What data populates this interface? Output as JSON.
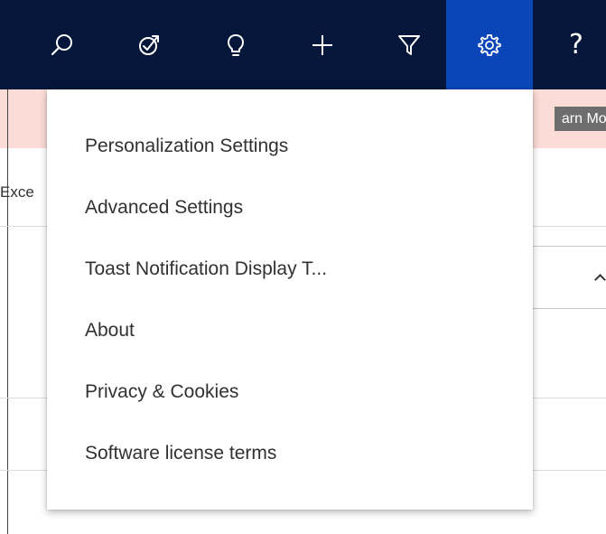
{
  "topbar": {
    "background": "#04173a",
    "active_background": "#0b46b8",
    "buttons": [
      {
        "icon": "search-icon"
      },
      {
        "icon": "task-flow-icon"
      },
      {
        "icon": "lightbulb-icon"
      },
      {
        "icon": "plus-icon"
      },
      {
        "icon": "filter-icon"
      },
      {
        "icon": "gear-icon",
        "active": true
      },
      {
        "icon": "help-icon",
        "glyph": "?"
      }
    ]
  },
  "background_page": {
    "banner_color": "#fbdcd6",
    "learn_more_label": "arn Mor",
    "excel_text": "Exce"
  },
  "settings_menu": {
    "items": [
      {
        "label": "Personalization Settings"
      },
      {
        "label": "Advanced Settings"
      },
      {
        "label": "Toast Notification Display T..."
      },
      {
        "label": "About"
      },
      {
        "label": "Privacy & Cookies"
      },
      {
        "label": "Software license terms"
      }
    ]
  }
}
